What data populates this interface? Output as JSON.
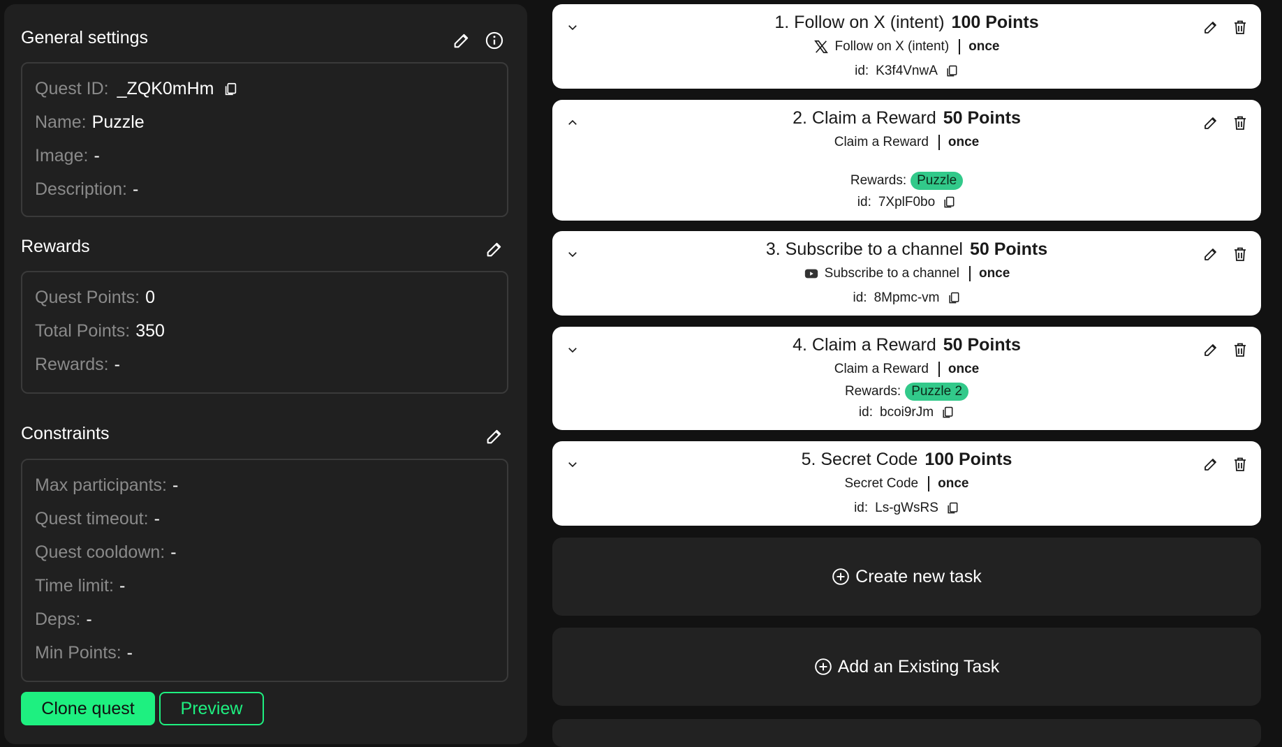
{
  "general": {
    "title": "General settings",
    "quest_id_label": "Quest ID:",
    "quest_id_value": "_ZQK0mHm",
    "name_label": "Name:",
    "name_value": "Puzzle",
    "image_label": "Image:",
    "image_value": "-",
    "description_label": "Description:",
    "description_value": "-"
  },
  "rewards": {
    "title": "Rewards",
    "quest_points_label": "Quest Points:",
    "quest_points_value": "0",
    "total_points_label": "Total Points:",
    "total_points_value": "350",
    "rewards_label": "Rewards:",
    "rewards_value": "-"
  },
  "constraints": {
    "title": "Constraints",
    "items": [
      {
        "label": "Max participants:",
        "value": "-"
      },
      {
        "label": "Quest timeout:",
        "value": "-"
      },
      {
        "label": "Quest cooldown:",
        "value": "-"
      },
      {
        "label": "Time limit:",
        "value": "-"
      },
      {
        "label": "Deps:",
        "value": "-"
      },
      {
        "label": "Min Points:",
        "value": "-"
      }
    ]
  },
  "actions": {
    "clone_label": "Clone quest",
    "preview_label": "Preview"
  },
  "tasks": [
    {
      "title": "1. Follow on X (intent)",
      "points": "100 Points",
      "subtitle": "Follow on X (intent)",
      "frequency": "once",
      "id_label": "id:",
      "id": "K3f4VnwA",
      "icon": "x-logo-icon",
      "expanded": false
    },
    {
      "title": "2. Claim a Reward",
      "points": "50 Points",
      "subtitle": "Claim a Reward",
      "frequency": "once",
      "rewards_label": "Rewards:",
      "reward": "Puzzle",
      "id_label": "id:",
      "id": "7XplF0bo",
      "expanded": true
    },
    {
      "title": "3. Subscribe to a channel",
      "points": "50 Points",
      "subtitle": "Subscribe to a channel",
      "frequency": "once",
      "id_label": "id:",
      "id": "8Mpmc-vm",
      "icon": "youtube-icon",
      "expanded": false
    },
    {
      "title": "4. Claim a Reward",
      "points": "50 Points",
      "subtitle": "Claim a Reward",
      "frequency": "once",
      "rewards_label": "Rewards:",
      "reward": "Puzzle 2",
      "id_label": "id:",
      "id": "bcoi9rJm",
      "expanded": false
    },
    {
      "title": "5. Secret Code",
      "points": "100 Points",
      "subtitle": "Secret Code",
      "frequency": "once",
      "id_label": "id:",
      "id": "Ls-gWsRS",
      "expanded": false
    }
  ],
  "create_task_label": "Create new task",
  "add_existing_label": "Add an Existing Task",
  "colors": {
    "accent": "#1ef080",
    "badge": "#32c98a",
    "panel": "#202020",
    "card": "#ffffff"
  }
}
